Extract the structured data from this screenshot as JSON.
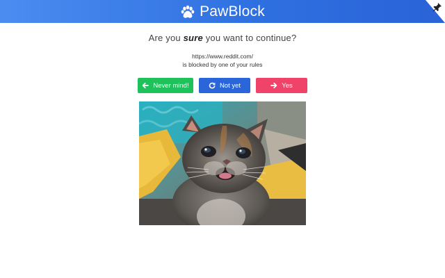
{
  "header": {
    "brand": "PawBlock",
    "brand_icon": "paw-icon",
    "corner_icon": "pin-icon",
    "colors": {
      "header_start": "#4a8cf0",
      "header_end": "#2a63d8"
    }
  },
  "prompt": {
    "before": "Are you ",
    "emphasis": "sure",
    "after": " you want to continue?"
  },
  "blocked": {
    "url": "https://www.reddit.com/",
    "message": "is blocked by one of your rules"
  },
  "buttons": {
    "never_mind": {
      "label": "Never mind!",
      "icon": "arrow-left-icon",
      "color": "#1ec15a"
    },
    "not_yet": {
      "label": "Not yet",
      "icon": "refresh-icon",
      "color": "#2a66d9"
    },
    "yes": {
      "label": "Yes",
      "icon": "arrow-right-icon",
      "color": "#f0436a"
    }
  },
  "image": {
    "subject": "kitten-photo"
  }
}
